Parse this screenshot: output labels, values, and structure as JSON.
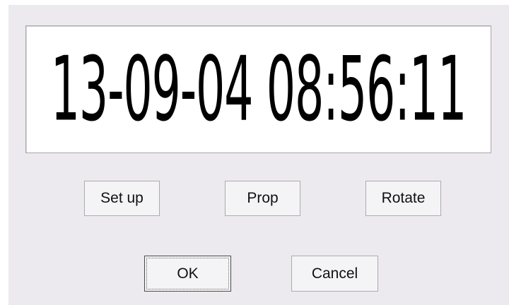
{
  "clock": {
    "display": "13-09-04 08:56:11"
  },
  "buttons": {
    "setup": "Set up",
    "prop": "Prop",
    "rotate": "Rotate",
    "ok": "OK",
    "cancel": "Cancel"
  },
  "colors": {
    "dialog_bg": "#ECEAEE",
    "display_bg": "#FFFFFF",
    "display_text": "#000000",
    "button_bg": "#F4F3F5"
  }
}
